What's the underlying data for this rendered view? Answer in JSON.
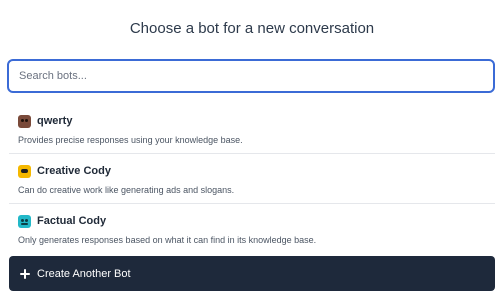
{
  "header": {
    "title": "Choose a bot for a new conversation"
  },
  "search": {
    "placeholder": "Search bots...",
    "value": ""
  },
  "bots": [
    {
      "name": "qwerty",
      "description": "Provides precise responses using your knowledge base.",
      "icon": "brown-bot-face-icon",
      "color": "#7a4a3a"
    },
    {
      "name": "Creative Cody",
      "description": "Can do creative work like generating ads and slogans.",
      "icon": "yellow-bot-face-icon",
      "color": "#f5b800"
    },
    {
      "name": "Factual Cody",
      "description": "Only generates responses based on what it can find in its knowledge base.",
      "icon": "teal-bot-face-icon",
      "color": "#22b8c8"
    }
  ],
  "create_button": {
    "label": "Create Another Bot",
    "icon": "plus-icon",
    "color": "#1e293b"
  },
  "colors": {
    "search_border": "#3b6bd6"
  }
}
